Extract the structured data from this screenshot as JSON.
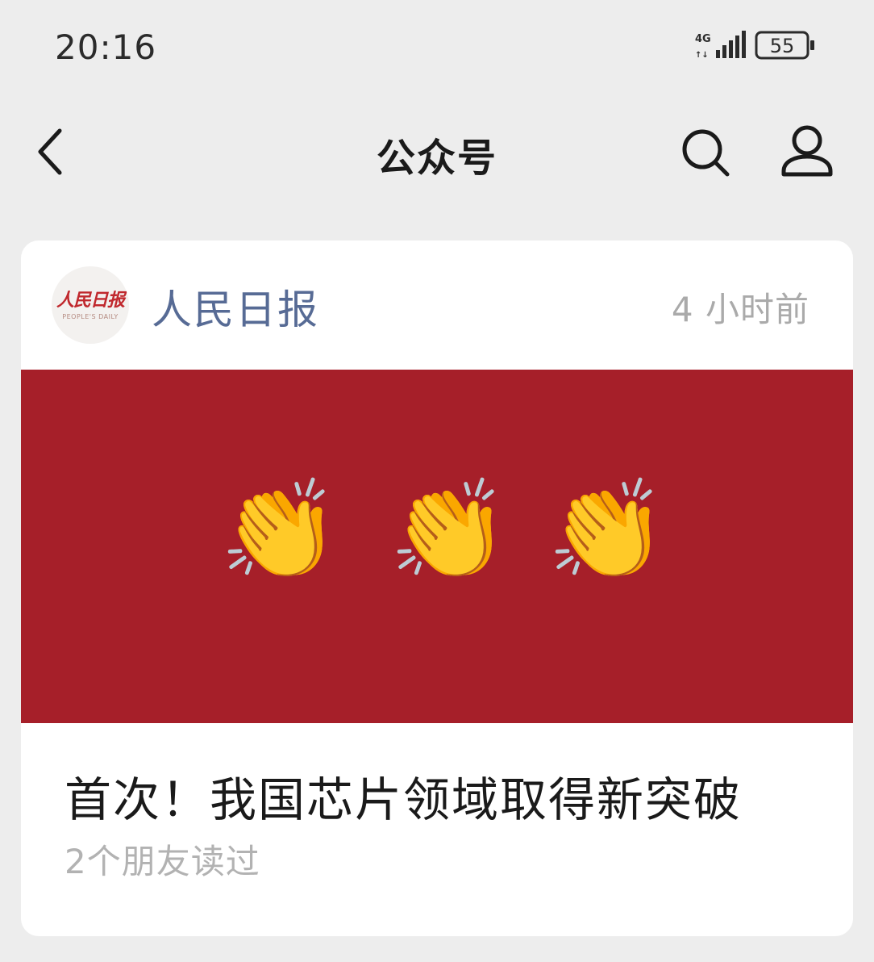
{
  "status_bar": {
    "time": "20:16",
    "network": "4G",
    "battery_level": "55"
  },
  "nav": {
    "title": "公众号",
    "icons": {
      "back": "chevron-left-icon",
      "search": "search-icon",
      "profile": "person-icon"
    }
  },
  "card": {
    "account": {
      "name": "人民日报",
      "avatar_text": "人民日报",
      "avatar_subtext": "PEOPLE'S DAILY"
    },
    "time_ago": "4 小时前",
    "cover": {
      "background_color": "#a61f29",
      "emojis": [
        "👏",
        "👏",
        "👏"
      ]
    },
    "title": "首次！我国芯片领域取得新突破",
    "read_by_friends": "2个朋友读过"
  }
}
